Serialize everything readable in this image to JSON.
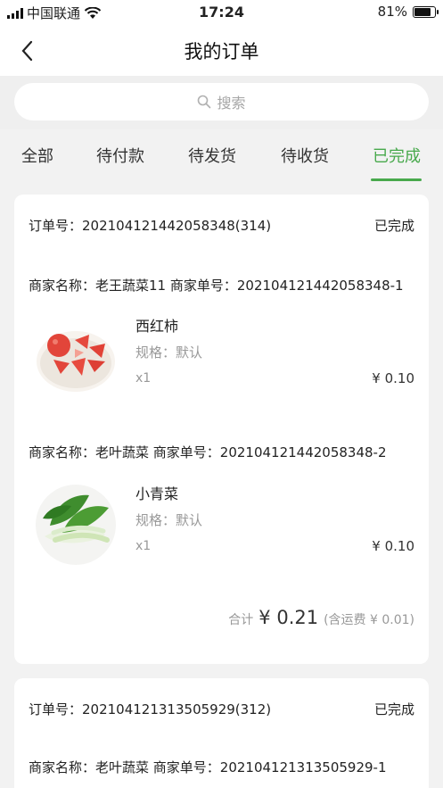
{
  "status_bar": {
    "carrier": "中国联通",
    "time": "17:24",
    "battery": "81%",
    "battery_level": 0.81
  },
  "navbar": {
    "title": "我的订单"
  },
  "search": {
    "placeholder": "搜索"
  },
  "tabs": [
    {
      "label": "全部",
      "active": false
    },
    {
      "label": "待付款",
      "active": false
    },
    {
      "label": "待发货",
      "active": false
    },
    {
      "label": "待收货",
      "active": false
    },
    {
      "label": "已完成",
      "active": true
    }
  ],
  "colors": {
    "accent": "#48a94c",
    "background": "#f2f2f2"
  },
  "orders": [
    {
      "order_no": "订单号：202104121442058348(314)",
      "status": "已完成",
      "merchants": [
        {
          "line": "商家名称：老王蔬菜11  商家单号：202104121442058348-1",
          "product": {
            "name": "西红柿",
            "spec": "规格：默认",
            "qty": "x1",
            "price": "¥ 0.10",
            "image": "tomato-image"
          }
        },
        {
          "line": "商家名称：老叶蔬菜    商家单号：202104121442058348-2",
          "product": {
            "name": "小青菜",
            "spec": "规格：默认",
            "qty": "x1",
            "price": "¥ 0.10",
            "image": "bok-choy-image"
          }
        }
      ],
      "total": {
        "label": "合计",
        "amount": "¥ 0.21",
        "note": "(含运费 ¥ 0.01)"
      }
    },
    {
      "order_no": "订单号：202104121313505929(312)",
      "status": "已完成",
      "merchants": [
        {
          "line": "商家名称：老叶蔬菜    商家单号：202104121313505929-1"
        }
      ]
    }
  ]
}
